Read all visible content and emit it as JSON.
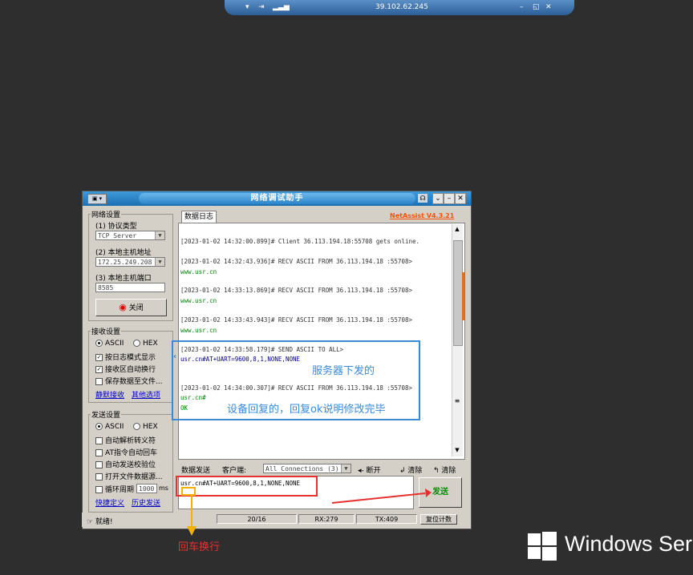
{
  "remote_bar": {
    "ip": "39.102.62.245",
    "min": "–",
    "restore": "◱",
    "close": "✕"
  },
  "window": {
    "title": "网络调试助手",
    "brand": "NetAssist V4.3.21"
  },
  "network": {
    "group": "网络设置",
    "protocol_label": "(1) 协议类型",
    "protocol_value": "TCP Server",
    "host_label": "(2) 本地主机地址",
    "host_value": "172.25.249.208",
    "port_label": "(3) 本地主机端口",
    "port_value": "8585",
    "close_button": "关闭"
  },
  "receive": {
    "group": "接收设置",
    "ascii": "ASCII",
    "hex": "HEX",
    "opt1": "按日志模式显示",
    "opt2": "接收区自动换行",
    "opt3": "保存数据至文件...",
    "link1": "静默接收",
    "link2": "其他选项"
  },
  "send": {
    "group": "发送设置",
    "ascii": "ASCII",
    "hex": "HEX",
    "opt1": "自动解析转义符",
    "opt2": "AT指令自动回车",
    "opt3": "自动发送校验位",
    "opt4": "打开文件数据源...",
    "opt5": "循环周期",
    "period": "1000",
    "unit": "ms",
    "link1": "快捷定义",
    "link2": "历史发送"
  },
  "log": {
    "tab": "数据日志",
    "lines": [
      "[2023-01-02 14:32:00.899]# Client 36.113.194.18:55708 gets online.",
      "[2023-01-02 14:32:43.936]# RECV ASCII FROM 36.113.194.18 :55708>",
      "www.usr.cn",
      "[2023-01-02 14:33:13.869]# RECV ASCII FROM 36.113.194.18 :55708>",
      "www.usr.cn",
      "[2023-01-02 14:33:43.943]# RECV ASCII FROM 36.113.194.18 :55708>",
      "www.usr.cn",
      "[2023-01-02 14:33:58.179]# SEND ASCII TO ALL>",
      "usr.cn#AT+UART=9600,8,1,NONE,NONE",
      "[2023-01-02 14:34:00.307]# RECV ASCII FROM 36.113.194.18 :55708>",
      "usr.cn#",
      "OK"
    ]
  },
  "sendbar": {
    "tab": "数据发送",
    "client_label": "客户端:",
    "client_value": "All Connections (3)",
    "disconnect": "断开",
    "clear1": "清除",
    "clear2": "清除",
    "input": "usr.cn#AT+UART=9600,8,1,NONE,NONE",
    "send_button": "发送"
  },
  "statusbar": {
    "ready": "就绪!",
    "count": "20/16",
    "rx": "RX:279",
    "tx": "TX:409",
    "reset": "复位计数"
  },
  "annotations": {
    "server_sent": "服务器下发的",
    "device_reply": "设备回复的，回复ok说明修改完毕",
    "crlf": "回车换行"
  },
  "windows_logo": "Windows Ser"
}
